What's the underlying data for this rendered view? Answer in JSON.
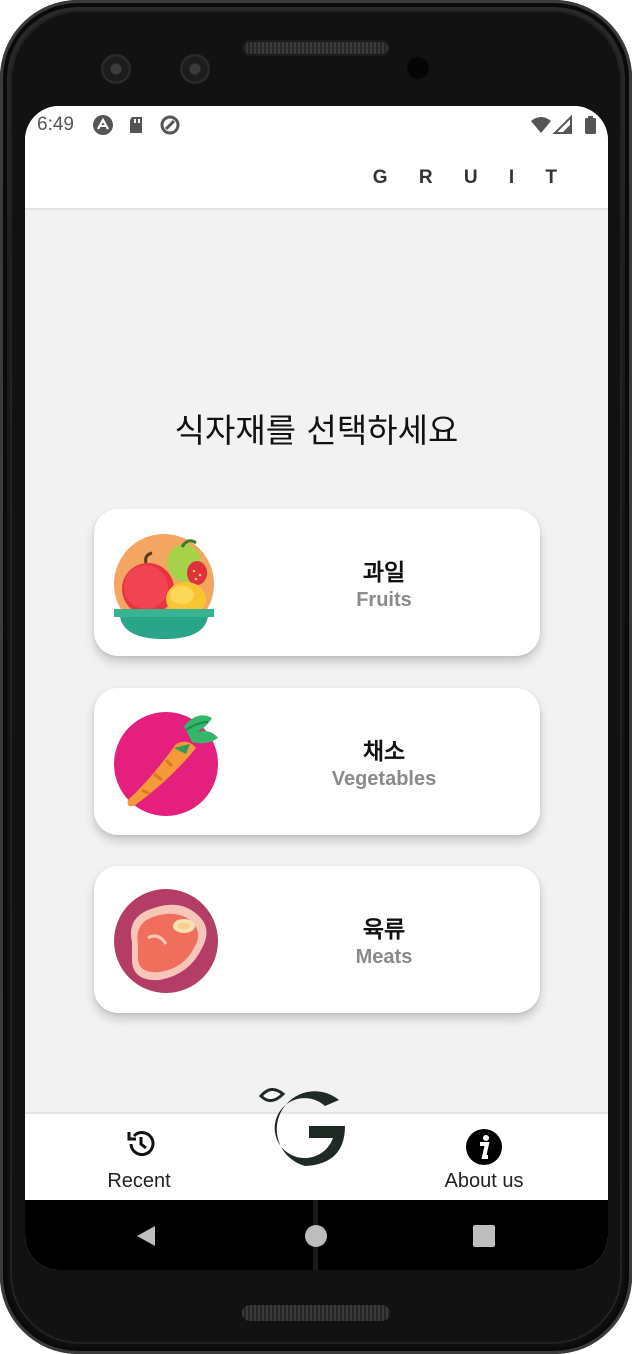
{
  "status_bar": {
    "time": "6:49",
    "icons_left": [
      "android-icon",
      "sd-card-icon",
      "sync-icon"
    ],
    "icons_right": [
      "wifi-icon",
      "signal-icon",
      "battery-icon"
    ]
  },
  "app_bar": {
    "brand": "G R U I T"
  },
  "main": {
    "prompt": "식자재를 선택하세요",
    "categories": [
      {
        "ko": "과일",
        "en": "Fruits",
        "icon": "fruit-basket-icon"
      },
      {
        "ko": "채소",
        "en": "Vegetables",
        "icon": "carrot-icon"
      },
      {
        "ko": "육류",
        "en": "Meats",
        "icon": "steak-icon"
      }
    ]
  },
  "bottom_nav": {
    "recent_label": "Recent",
    "about_label": "About us",
    "center_logo": "gruit-logo-icon"
  },
  "colors": {
    "background": "#f2f2f2",
    "card": "#ffffff",
    "subtitle": "#8a8a8a",
    "logo": "#1f2a24"
  }
}
